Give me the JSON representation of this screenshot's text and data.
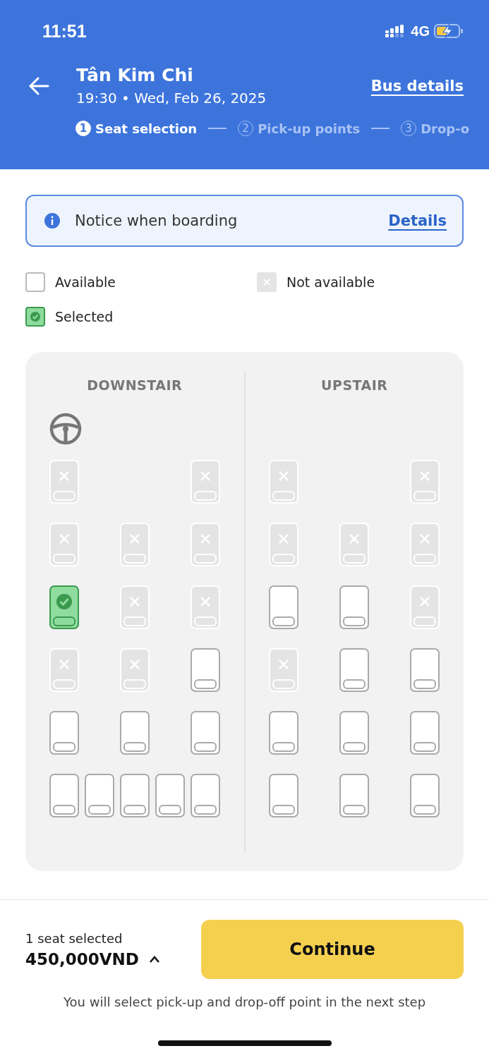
{
  "status_bar": {
    "time": "11:51",
    "network": "4G"
  },
  "header": {
    "title": "Tân Kim Chi",
    "subtitle": "19:30 • Wed, Feb 26, 2025",
    "link": "Bus details"
  },
  "steps": [
    {
      "number": "1",
      "label": "Seat selection",
      "selected": true
    },
    {
      "number": "2",
      "label": "Pick-up points",
      "selected": false
    },
    {
      "number": "3",
      "label": "Drop-o",
      "selected": false
    }
  ],
  "notice": {
    "text": "Notice when boarding",
    "link": "Details"
  },
  "legend": [
    {
      "kind": "available",
      "label": "Available"
    },
    {
      "kind": "unavailable",
      "label": "Not available"
    },
    {
      "kind": "selected",
      "label": "Selected"
    }
  ],
  "decks": [
    {
      "title": "DOWNSTAIR",
      "driver_seat": true,
      "rows": [
        [
          {
            "available": false,
            "selected": false
          },
          null,
          null,
          null,
          {
            "available": false,
            "selected": false
          }
        ],
        [
          {
            "available": false,
            "selected": false
          },
          null,
          {
            "available": false,
            "selected": false
          },
          null,
          {
            "available": false,
            "selected": false
          }
        ],
        [
          {
            "available": true,
            "selected": true
          },
          null,
          {
            "available": false,
            "selected": false
          },
          null,
          {
            "available": false,
            "selected": false
          }
        ],
        [
          {
            "available": false,
            "selected": false
          },
          null,
          {
            "available": false,
            "selected": false
          },
          null,
          {
            "available": true,
            "selected": false
          }
        ],
        [
          {
            "available": true,
            "selected": false
          },
          null,
          {
            "available": true,
            "selected": false
          },
          null,
          {
            "available": true,
            "selected": false
          }
        ],
        [
          {
            "available": true,
            "selected": false
          },
          {
            "available": true,
            "selected": false
          },
          {
            "available": true,
            "selected": false
          },
          {
            "available": true,
            "selected": false
          },
          {
            "available": true,
            "selected": false
          }
        ]
      ]
    },
    {
      "title": "UPSTAIR",
      "driver_seat": false,
      "rows": [
        [
          {
            "available": false,
            "selected": false
          },
          null,
          null,
          null,
          {
            "available": false,
            "selected": false
          }
        ],
        [
          {
            "available": false,
            "selected": false
          },
          null,
          {
            "available": false,
            "selected": false
          },
          null,
          {
            "available": false,
            "selected": false
          }
        ],
        [
          {
            "available": true,
            "selected": false
          },
          null,
          {
            "available": true,
            "selected": false
          },
          null,
          {
            "available": false,
            "selected": false
          }
        ],
        [
          {
            "available": false,
            "selected": false
          },
          null,
          {
            "available": true,
            "selected": false
          },
          null,
          {
            "available": true,
            "selected": false
          }
        ],
        [
          {
            "available": true,
            "selected": false
          },
          null,
          {
            "available": true,
            "selected": false
          },
          null,
          {
            "available": true,
            "selected": false
          }
        ],
        [
          {
            "available": true,
            "selected": false
          },
          null,
          {
            "available": true,
            "selected": false
          },
          null,
          {
            "available": true,
            "selected": false
          }
        ]
      ]
    }
  ],
  "footer": {
    "count": "1 seat selected",
    "price": "450,000VND",
    "button": "Continue",
    "note": "You will select pick-up and drop-off point in the next step"
  }
}
